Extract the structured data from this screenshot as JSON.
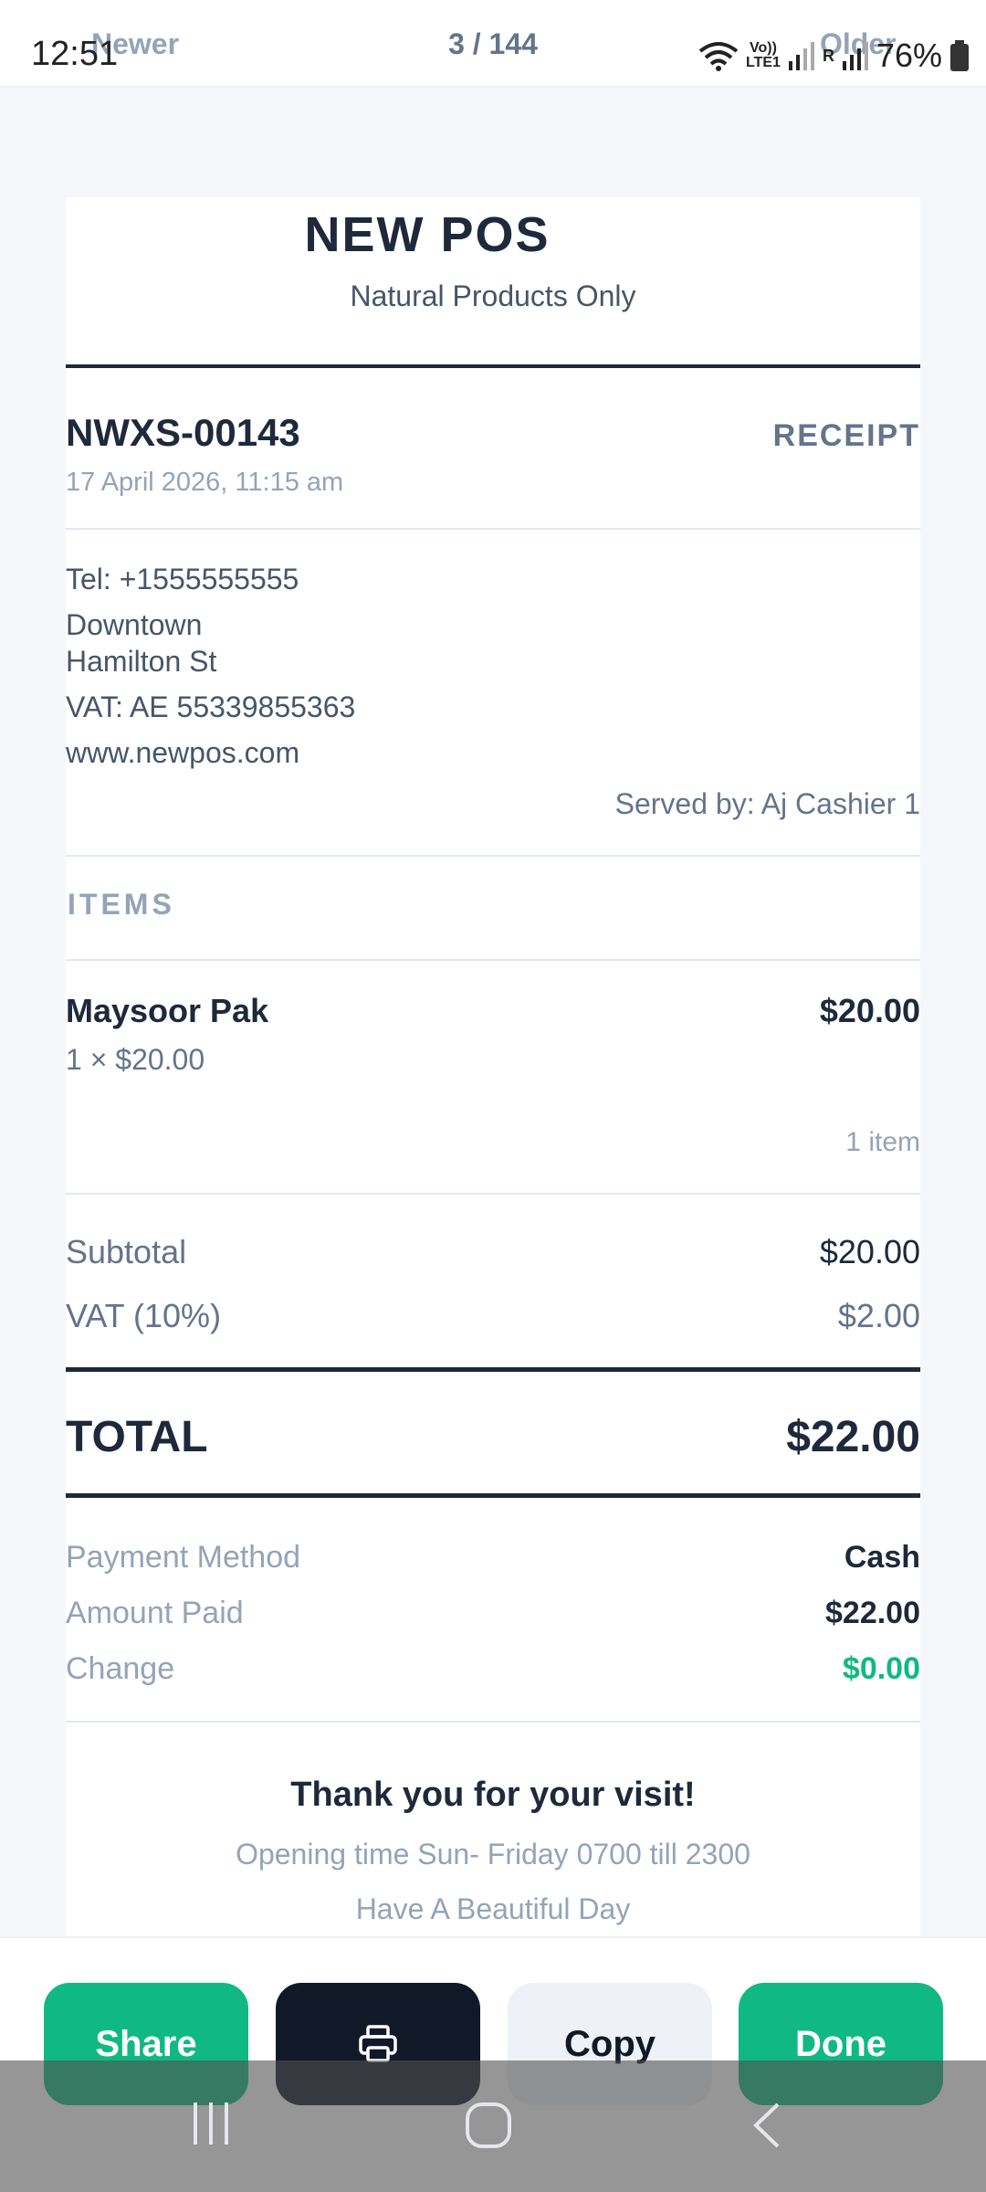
{
  "status_bar": {
    "time": "12:51",
    "volte_line1": "Vo))",
    "volte_line2": "LTE1",
    "sim_label": "R",
    "battery": "76%"
  },
  "pager": {
    "newer": "Newer",
    "count": "3 / 144",
    "older": "Older"
  },
  "store": {
    "name": "NEW POS",
    "tagline": "Natural Products Only"
  },
  "receipt": {
    "number": "NWXS-00143",
    "type": "RECEIPT",
    "datetime": "17 April 2026, 11:15 am",
    "tel": "Tel: +1555555555",
    "address_line1": "Downtown",
    "address_line2": "Hamilton St",
    "vat_number": "VAT: AE 55339855363",
    "website": "www.newpos.com",
    "served_by": "Served by: Aj Cashier 1"
  },
  "items_section": {
    "header": "ITEMS",
    "items": [
      {
        "name": "Maysoor Pak",
        "qty_price": "1 × $20.00",
        "amount": "$20.00"
      }
    ],
    "count": "1 item"
  },
  "totals": {
    "subtotal_label": "Subtotal",
    "subtotal_value": "$20.00",
    "vat_label": "VAT (10%)",
    "vat_value": "$2.00",
    "total_label": "TOTAL",
    "total_value": "$22.00"
  },
  "payment": {
    "method_label": "Payment Method",
    "method_value": "Cash",
    "paid_label": "Amount Paid",
    "paid_value": "$22.00",
    "change_label": "Change",
    "change_value": "$0.00"
  },
  "footer": {
    "thanks": "Thank you for your visit!",
    "hours": "Opening time Sun- Friday 0700 till 2300",
    "message": "Have A Beautiful Day"
  },
  "actions": {
    "share": "Share",
    "print_icon": "printer-icon",
    "copy": "Copy",
    "done": "Done"
  },
  "colors": {
    "accent_green": "#10b981",
    "dark": "#111827",
    "change_green": "#10b981"
  }
}
